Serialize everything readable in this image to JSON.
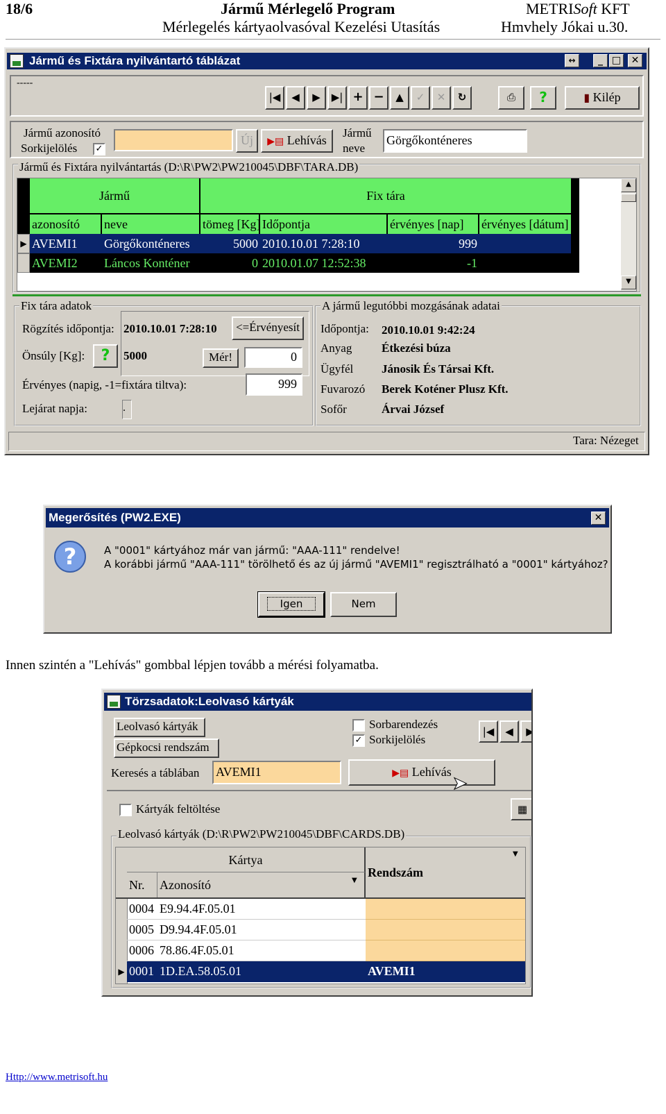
{
  "header": {
    "page": "18/6",
    "title": "Jármű Mérlegelő Program",
    "company_pre": "METRI",
    "company_italic": "Soft",
    "company_post": " KFT",
    "subtitle": "Mérlegelés kártyaolvasóval Kezelési Utasítás",
    "address": "Hmvhely Jókai u.30."
  },
  "win1": {
    "title": "Jármű és Fixtára nyilvántartó táblázat",
    "menu_label": "-----",
    "toolbar_icons": [
      "first-icon",
      "prev-icon",
      "next-icon",
      "last-icon",
      "plus-icon",
      "minus-icon",
      "up-icon",
      "check-icon",
      "cancel-icon",
      "refresh-icon"
    ],
    "toolbar_glyphs": [
      "|◀",
      "◀",
      "▶",
      "▶|",
      "+",
      "−",
      "▲",
      "✓",
      "✕",
      "↻"
    ],
    "kilep": "Kilép",
    "id_label": "Jármű azonosító",
    "sort_label": "Sorkijelölés",
    "uj": "Új",
    "lehivas": "Lehívás",
    "jarmu_label1": "Jármű",
    "jarmu_label2": "neve",
    "jarmu_name": "Görgőkonténeres",
    "table_group": "Jármű és Fixtára nyilvántartás (D:\\R\\PW2\\PW210045\\DBF\\TARA.DB)",
    "band_left": "Jármű",
    "band_right": "Fix tára",
    "columns": [
      "azonosító",
      "neve",
      "tömeg [Kg]",
      "Időpontja",
      "érvényes [nap]",
      "érvényes [dátum]"
    ],
    "rows": [
      [
        "AVEMI1",
        "Görgőkonténeres",
        "5000",
        "2010.10.01 7:28:10",
        "999",
        ""
      ],
      [
        "AVEMI2",
        "Láncos Konténer",
        "0",
        "2010.01.07 12:52:38",
        "-1",
        ""
      ]
    ],
    "fix_group": "Fix tára adatok",
    "rogzites_label": "Rögzítés időpontja:",
    "rogzites_value": "2010.10.01 7:28:10",
    "ervenyesit": "<=Érvényesít",
    "onsuly_label": "Önsúly [Kg]:",
    "onsuly_value": "5000",
    "mer": "Mér!",
    "mer_value": "0",
    "ervenyes_label": "Érvényes (napig, -1=fixtára tiltva):",
    "ervenyes_value": "999",
    "lejarat_label": "Lejárat napja:",
    "lejarat_value": ".",
    "move_group": "A jármű legutóbbi mozgásának adatai",
    "move": [
      {
        "label": "Időpontja:",
        "value": "2010.10.01 9:42:24"
      },
      {
        "label": "Anyag",
        "value": "Étkezési búza"
      },
      {
        "label": "Ügyfél",
        "value": "Jánosik És Társai Kft."
      },
      {
        "label": "Fuvarozó",
        "value": "Berek Koténer Plusz Kft."
      },
      {
        "label": "Sofőr",
        "value": "Árvai József"
      }
    ],
    "status": "Tara: Nézeget"
  },
  "dialog": {
    "title": "Megerősítés (PW2.EXE)",
    "line1": "A \"0001\" kártyához már van jármű: \"AAA-111\" rendelve!",
    "line2": "A korábbi jármű \"AAA-111\" törölhető és az új jármű \"AVEMI1\" regisztrálható a \"0001\" kártyához?",
    "yes": "Igen",
    "no": "Nem"
  },
  "body_text": "Innen szintén a \"Lehívás\" gombbal lépjen tovább a mérési folyamatba.",
  "win2": {
    "title": "Törzsadatok:Leolvasó kártyák",
    "tab1": "Leolvasó kártyák",
    "tab2": "Gépkocsi rendszám",
    "sorbarendezes": "Sorbarendezés",
    "sorkijeloles": "Sorkijelölés",
    "search_label": "Keresés a táblában",
    "search_value": "AVEMI1",
    "lehivas": "Lehívás",
    "feltoltes": "Kártyák feltöltése",
    "group": "Leolvasó kártyák (D:\\R\\PW2\\PW210045\\DBF\\CARDS.DB)",
    "band": "Kártya",
    "col_nr": "Nr.",
    "col_azon": "Azonosító",
    "col_rend": "Rendszám",
    "rows": [
      [
        "0004",
        "E9.94.4F.05.01",
        ""
      ],
      [
        "0005",
        "D9.94.4F.05.01",
        ""
      ],
      [
        "0006",
        "78.86.4F.05.01",
        ""
      ],
      [
        "0001",
        "1D.EA.58.05.01",
        "AVEMI1"
      ]
    ]
  },
  "footer": {
    "url": "Http://www.metrisoft.hu"
  }
}
